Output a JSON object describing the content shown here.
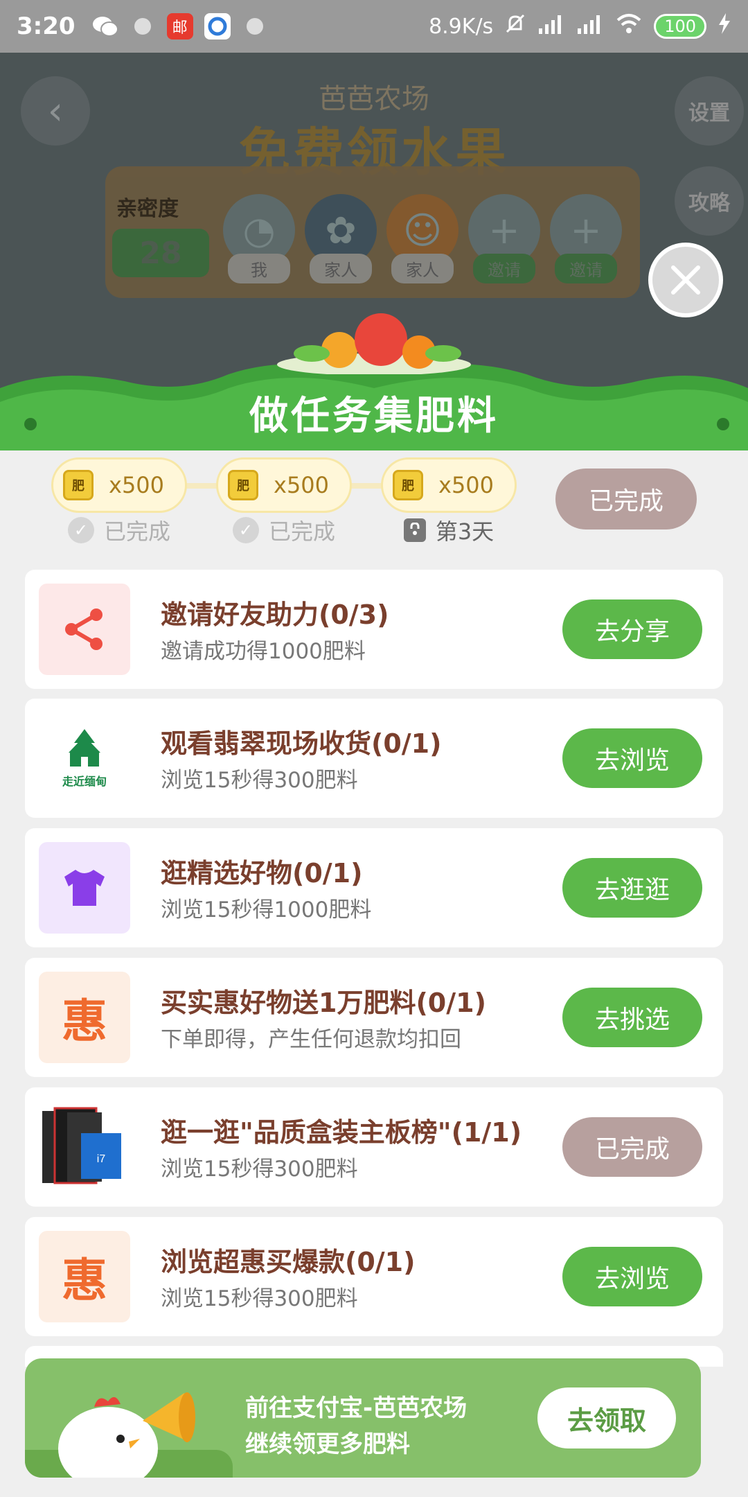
{
  "status_bar": {
    "time": "3:20",
    "icons": [
      "wechat-icon",
      "dot-icon",
      "post-icon",
      "browser-icon",
      "dot-icon"
    ],
    "post_label": "邮",
    "speed": "8.9K/s",
    "battery": "100"
  },
  "background": {
    "farm_name": "芭芭农场",
    "banner_title": "免费领水果",
    "settings_label": "设置",
    "guide_label": "攻略",
    "affinity_label": "亲密度",
    "affinity_value": "28",
    "members": [
      "我",
      "家人",
      "家人",
      "邀请",
      "邀请"
    ]
  },
  "popup": {
    "title": "做任务集肥料",
    "checkin": {
      "rewards": [
        {
          "amount": "x500",
          "status": "已完成"
        },
        {
          "amount": "x500",
          "status": "已完成"
        },
        {
          "amount": "x500",
          "status": "第3天"
        }
      ],
      "icon_label": "肥",
      "completed_button": "已完成"
    },
    "tasks": [
      {
        "title": "邀请好友助力(0/3)",
        "desc": "邀请成功得1000肥料",
        "action": "去分享",
        "icon": "share-icon",
        "done": false
      },
      {
        "title": "观看翡翠现场收货(0/1)",
        "desc": "浏览15秒得300肥料",
        "action": "去浏览",
        "icon": "myanmar-logo",
        "done": false
      },
      {
        "title": "逛精选好物(0/1)",
        "desc": "浏览15秒得1000肥料",
        "action": "去逛逛",
        "icon": "tshirt-icon",
        "done": false
      },
      {
        "title": "买实惠好物送1万肥料(0/1)",
        "desc": "下单即得，产生任何退款均扣回",
        "action": "去挑选",
        "icon": "hui-icon",
        "done": false
      },
      {
        "title": "逛一逛\"品质盒装主板榜\"(1/1)",
        "desc": "浏览15秒得300肥料",
        "action": "已完成",
        "icon": "motherboard-image",
        "done": true
      },
      {
        "title": "浏览超惠买爆款(0/1)",
        "desc": "浏览15秒得300肥料",
        "action": "去浏览",
        "icon": "hui-icon",
        "done": false
      }
    ],
    "hui_char": "惠",
    "myanmar_logo_text": "走近缅甸"
  },
  "promo": {
    "line1": "前往支付宝-芭芭农场",
    "line2": "继续领更多肥料",
    "cta": "去领取"
  },
  "colors": {
    "primary_green": "#5cb84a",
    "done_button": "#b7a09e",
    "title_brown": "#7a3f2d"
  }
}
